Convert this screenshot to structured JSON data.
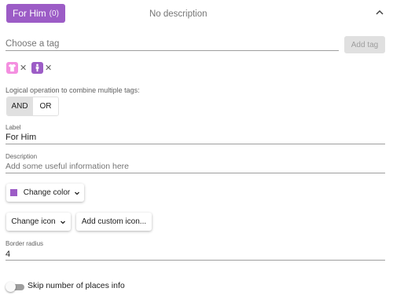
{
  "header": {
    "tag_name": "For Him",
    "tag_count": "(0)",
    "description_text": "No description",
    "tag_color": "#9c5cc6"
  },
  "tag_search": {
    "placeholder": "Choose a tag",
    "add_button_label": "Add tag"
  },
  "selected_tags": [
    {
      "icon": "shirt-icon",
      "color": "#f48fe0"
    },
    {
      "icon": "man-icon",
      "color": "#9c5cc6"
    }
  ],
  "logic": {
    "label": "Logical operation to combine multiple tags:",
    "options": [
      "AND",
      "OR"
    ],
    "selected": "AND"
  },
  "label_field": {
    "label": "Label",
    "value": "For Him"
  },
  "description_field": {
    "label": "Description",
    "placeholder": "Add some useful information here"
  },
  "color_button": {
    "label": "Change color",
    "swatch_color": "#9c5cc6"
  },
  "icon_button": {
    "label": "Change icon"
  },
  "custom_icon_button": {
    "label": "Add custom icon..."
  },
  "border_radius_field": {
    "label": "Border radius",
    "value": "4"
  },
  "skip_toggle": {
    "label": "Skip number of places info",
    "on": false
  }
}
